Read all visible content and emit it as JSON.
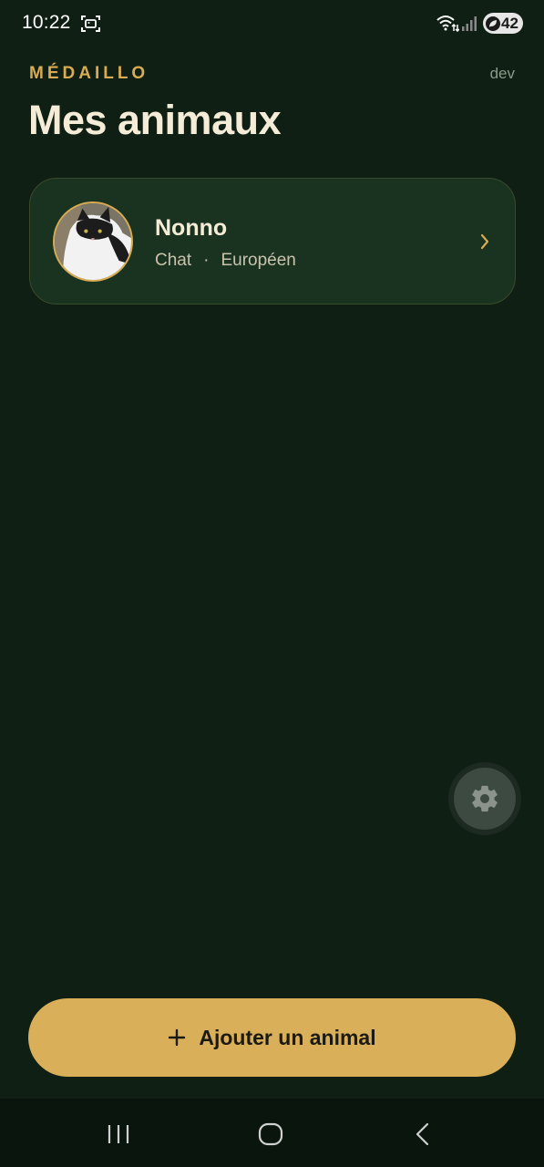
{
  "status_bar": {
    "time": "10:22",
    "battery_level": "42",
    "icons": [
      "screenshot-icon",
      "wifi-icon",
      "signal-icon",
      "battery-saver-leaf-icon"
    ]
  },
  "header": {
    "brand": "MÉDAILLO",
    "env_tag": "dev",
    "title": "Mes animaux"
  },
  "pets": [
    {
      "name": "Nonno",
      "species": "Chat",
      "separator": "·",
      "breed": "Européen"
    }
  ],
  "fab": {
    "icon": "gear-icon"
  },
  "add_button": {
    "label": "Ajouter un animal",
    "icon": "plus-icon"
  },
  "nav_bar": {
    "icons": [
      "recent-apps-icon",
      "home-icon",
      "back-icon"
    ]
  },
  "colors": {
    "background": "#0f1f14",
    "accent": "#d9ac52",
    "card": "#1a3220",
    "button": "#d9b059",
    "title": "#f5ecd8"
  }
}
